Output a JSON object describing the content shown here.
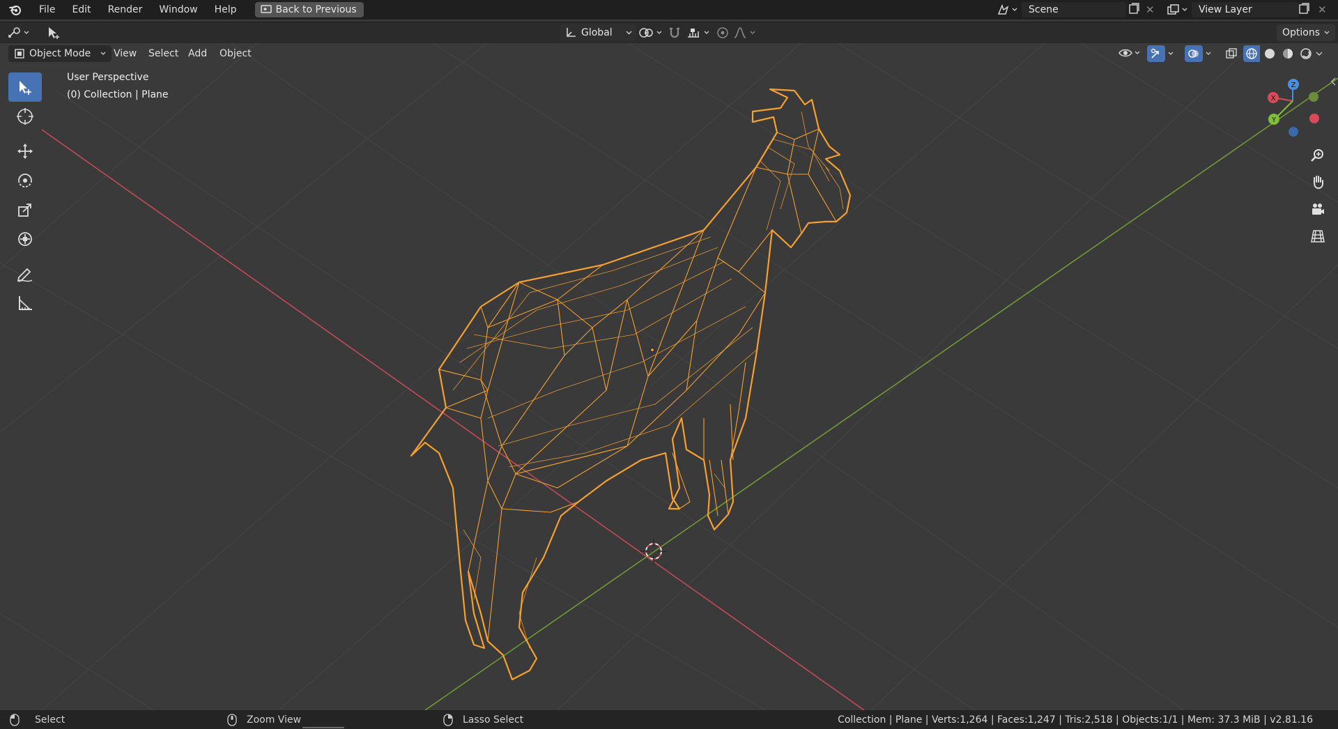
{
  "app": {
    "menus": [
      "File",
      "Edit",
      "Render",
      "Window",
      "Help"
    ],
    "back_button": "Back to Previous",
    "scene_name": "Scene",
    "view_layer_name": "View Layer"
  },
  "tool_header": {
    "transform_orientation": "Global",
    "options_label": "Options"
  },
  "viewport_header": {
    "mode": "Object Mode",
    "menus": [
      "View",
      "Select",
      "Add",
      "Object"
    ]
  },
  "viewport": {
    "perspective_label": "User Perspective",
    "collection_label": "(0) Collection | Plane",
    "gizmo_axes": {
      "x": "X",
      "y": "Y",
      "z": "Z"
    }
  },
  "statusbar": {
    "left_action": "Select",
    "middle_action": "Zoom View",
    "right_action": "Lasso Select",
    "stats": "Collection | Plane | Verts:1,264 | Faces:1,247 | Tris:2,518 | Objects:1/1 | Mem: 37.3 MiB | v2.81.16"
  },
  "colors": {
    "selection_orange": "#f5a030",
    "axis_x": "#d94a5a",
    "axis_y": "#7fbf3a",
    "axis_z": "#4a8fe0",
    "active_tool": "#4772b3"
  }
}
